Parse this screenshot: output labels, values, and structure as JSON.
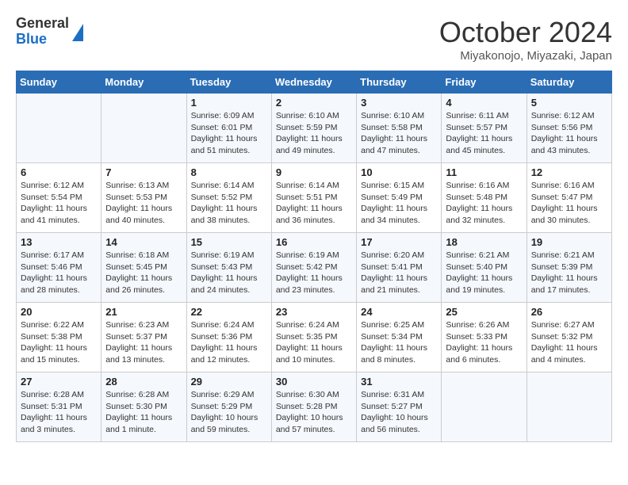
{
  "logo": {
    "general": "General",
    "blue": "Blue"
  },
  "header": {
    "month": "October 2024",
    "location": "Miyakonojo, Miyazaki, Japan"
  },
  "days_of_week": [
    "Sunday",
    "Monday",
    "Tuesday",
    "Wednesday",
    "Thursday",
    "Friday",
    "Saturday"
  ],
  "weeks": [
    [
      {
        "day": "",
        "info": ""
      },
      {
        "day": "",
        "info": ""
      },
      {
        "day": "1",
        "info": "Sunrise: 6:09 AM\nSunset: 6:01 PM\nDaylight: 11 hours and 51 minutes."
      },
      {
        "day": "2",
        "info": "Sunrise: 6:10 AM\nSunset: 5:59 PM\nDaylight: 11 hours and 49 minutes."
      },
      {
        "day": "3",
        "info": "Sunrise: 6:10 AM\nSunset: 5:58 PM\nDaylight: 11 hours and 47 minutes."
      },
      {
        "day": "4",
        "info": "Sunrise: 6:11 AM\nSunset: 5:57 PM\nDaylight: 11 hours and 45 minutes."
      },
      {
        "day": "5",
        "info": "Sunrise: 6:12 AM\nSunset: 5:56 PM\nDaylight: 11 hours and 43 minutes."
      }
    ],
    [
      {
        "day": "6",
        "info": "Sunrise: 6:12 AM\nSunset: 5:54 PM\nDaylight: 11 hours and 41 minutes."
      },
      {
        "day": "7",
        "info": "Sunrise: 6:13 AM\nSunset: 5:53 PM\nDaylight: 11 hours and 40 minutes."
      },
      {
        "day": "8",
        "info": "Sunrise: 6:14 AM\nSunset: 5:52 PM\nDaylight: 11 hours and 38 minutes."
      },
      {
        "day": "9",
        "info": "Sunrise: 6:14 AM\nSunset: 5:51 PM\nDaylight: 11 hours and 36 minutes."
      },
      {
        "day": "10",
        "info": "Sunrise: 6:15 AM\nSunset: 5:49 PM\nDaylight: 11 hours and 34 minutes."
      },
      {
        "day": "11",
        "info": "Sunrise: 6:16 AM\nSunset: 5:48 PM\nDaylight: 11 hours and 32 minutes."
      },
      {
        "day": "12",
        "info": "Sunrise: 6:16 AM\nSunset: 5:47 PM\nDaylight: 11 hours and 30 minutes."
      }
    ],
    [
      {
        "day": "13",
        "info": "Sunrise: 6:17 AM\nSunset: 5:46 PM\nDaylight: 11 hours and 28 minutes."
      },
      {
        "day": "14",
        "info": "Sunrise: 6:18 AM\nSunset: 5:45 PM\nDaylight: 11 hours and 26 minutes."
      },
      {
        "day": "15",
        "info": "Sunrise: 6:19 AM\nSunset: 5:43 PM\nDaylight: 11 hours and 24 minutes."
      },
      {
        "day": "16",
        "info": "Sunrise: 6:19 AM\nSunset: 5:42 PM\nDaylight: 11 hours and 23 minutes."
      },
      {
        "day": "17",
        "info": "Sunrise: 6:20 AM\nSunset: 5:41 PM\nDaylight: 11 hours and 21 minutes."
      },
      {
        "day": "18",
        "info": "Sunrise: 6:21 AM\nSunset: 5:40 PM\nDaylight: 11 hours and 19 minutes."
      },
      {
        "day": "19",
        "info": "Sunrise: 6:21 AM\nSunset: 5:39 PM\nDaylight: 11 hours and 17 minutes."
      }
    ],
    [
      {
        "day": "20",
        "info": "Sunrise: 6:22 AM\nSunset: 5:38 PM\nDaylight: 11 hours and 15 minutes."
      },
      {
        "day": "21",
        "info": "Sunrise: 6:23 AM\nSunset: 5:37 PM\nDaylight: 11 hours and 13 minutes."
      },
      {
        "day": "22",
        "info": "Sunrise: 6:24 AM\nSunset: 5:36 PM\nDaylight: 11 hours and 12 minutes."
      },
      {
        "day": "23",
        "info": "Sunrise: 6:24 AM\nSunset: 5:35 PM\nDaylight: 11 hours and 10 minutes."
      },
      {
        "day": "24",
        "info": "Sunrise: 6:25 AM\nSunset: 5:34 PM\nDaylight: 11 hours and 8 minutes."
      },
      {
        "day": "25",
        "info": "Sunrise: 6:26 AM\nSunset: 5:33 PM\nDaylight: 11 hours and 6 minutes."
      },
      {
        "day": "26",
        "info": "Sunrise: 6:27 AM\nSunset: 5:32 PM\nDaylight: 11 hours and 4 minutes."
      }
    ],
    [
      {
        "day": "27",
        "info": "Sunrise: 6:28 AM\nSunset: 5:31 PM\nDaylight: 11 hours and 3 minutes."
      },
      {
        "day": "28",
        "info": "Sunrise: 6:28 AM\nSunset: 5:30 PM\nDaylight: 11 hours and 1 minute."
      },
      {
        "day": "29",
        "info": "Sunrise: 6:29 AM\nSunset: 5:29 PM\nDaylight: 10 hours and 59 minutes."
      },
      {
        "day": "30",
        "info": "Sunrise: 6:30 AM\nSunset: 5:28 PM\nDaylight: 10 hours and 57 minutes."
      },
      {
        "day": "31",
        "info": "Sunrise: 6:31 AM\nSunset: 5:27 PM\nDaylight: 10 hours and 56 minutes."
      },
      {
        "day": "",
        "info": ""
      },
      {
        "day": "",
        "info": ""
      }
    ]
  ]
}
